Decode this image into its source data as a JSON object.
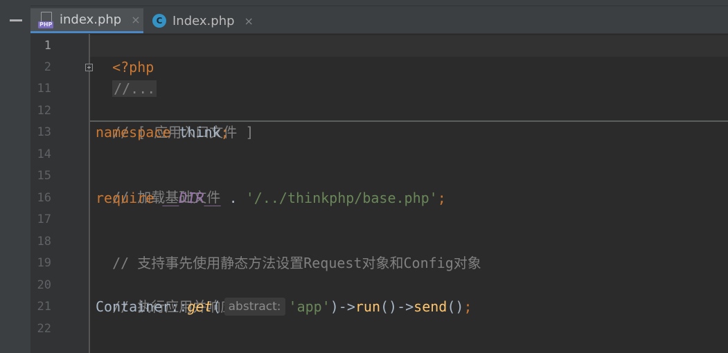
{
  "tabs": [
    {
      "label": "index.php",
      "icon": "php-file-icon",
      "active": true,
      "close": "×"
    },
    {
      "label": "Index.php",
      "icon": "php-class-icon",
      "active": false,
      "close": "×"
    }
  ],
  "icons": {
    "php_badge": "PHP",
    "class_badge": "C"
  },
  "line_numbers": [
    "1",
    "2",
    "11",
    "12",
    "13",
    "14",
    "15",
    "16",
    "17",
    "18",
    "19",
    "20",
    "21",
    "22"
  ],
  "code": {
    "l1_open_tag": "<?php",
    "l2_folded": "//...",
    "l12_comment": "// [ 应用入口文件 ]",
    "l13_namespace_kw": "namespace",
    "l13_ns_name": " think",
    "l13_semicolon": ";",
    "l15_comment": "// 加载基础文件",
    "l16_require_kw": "require",
    "l16_dir_const": "__DIR__",
    "l16_concat": " . ",
    "l16_path": "'/../thinkphp/base.php'",
    "l16_semicolon": ";",
    "l18_comment": "// 支持事先使用静态方法设置Request对象和Config对象",
    "l20_comment": "// 执行应用并响应",
    "l21_class": "Container",
    "l21_scope": "::",
    "l21_method": "get",
    "l21_paren_open": "(",
    "l21_param_hint": "abstract:",
    "l21_arg": "'app'",
    "l21_close_arrow1": ")->",
    "l21_run": "run",
    "l21_run_parens_arrow": "()->",
    "l21_send": "send",
    "l21_send_parens": "()",
    "l21_semicolon": ";"
  },
  "colors": {
    "background": "#2b2b2b",
    "keyword": "#cc7832",
    "comment": "#808080",
    "string": "#6a8759",
    "constant": "#9876aa",
    "function": "#ffc66d",
    "text": "#a9b7c6",
    "active_tab_underline": "#4a88c7"
  }
}
